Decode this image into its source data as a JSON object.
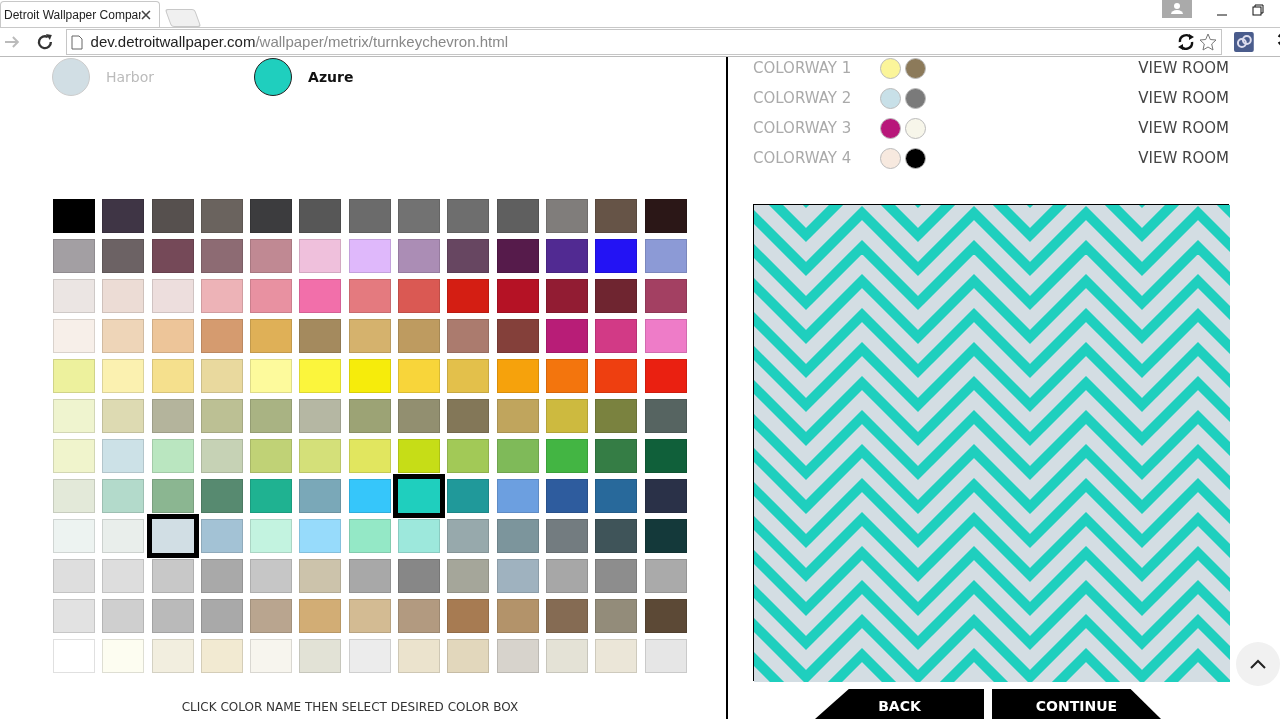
{
  "browser": {
    "tab_title": "Detroit Wallpaper Compar",
    "url": {
      "host": "dev.detroitwallpaper.com",
      "path": "/wallpaper/metrix/turnkeychevron.html"
    }
  },
  "color_choices": [
    {
      "name": "Harbor",
      "color": "#d1dee4",
      "selected": false
    },
    {
      "name": "Azure",
      "color": "#1fcfbe",
      "selected": true
    }
  ],
  "palette": {
    "rows": [
      [
        {
          "color": "#000000",
          "selected": false
        },
        {
          "color": "#3f3545",
          "selected": false
        },
        {
          "color": "#56504e",
          "selected": false
        },
        {
          "color": "#6a635e",
          "selected": false
        },
        {
          "color": "#3c3c3e",
          "selected": false
        },
        {
          "color": "#575757",
          "selected": false
        },
        {
          "color": "#6b6b6b",
          "selected": false
        },
        {
          "color": "#727272",
          "selected": false
        },
        {
          "color": "#6e6e6e",
          "selected": false
        },
        {
          "color": "#5f5f5f",
          "selected": false
        },
        {
          "color": "#807d7b",
          "selected": false
        },
        {
          "color": "#665447",
          "selected": false
        },
        {
          "color": "#2b1717",
          "selected": false
        }
      ],
      [
        {
          "color": "#a39fa3",
          "selected": false
        },
        {
          "color": "#6c6264",
          "selected": false
        },
        {
          "color": "#754958",
          "selected": false
        },
        {
          "color": "#8d6b73",
          "selected": false
        },
        {
          "color": "#c08993",
          "selected": false
        },
        {
          "color": "#efc0dc",
          "selected": false
        },
        {
          "color": "#dfb8fb",
          "selected": false
        },
        {
          "color": "#ab8db5",
          "selected": false
        },
        {
          "color": "#674661",
          "selected": false
        },
        {
          "color": "#561b4b",
          "selected": false
        },
        {
          "color": "#512a92",
          "selected": false
        },
        {
          "color": "#2313f4",
          "selected": false
        },
        {
          "color": "#8c9ad6",
          "selected": false
        }
      ],
      [
        {
          "color": "#ebe5e3",
          "selected": false
        },
        {
          "color": "#ecdcd5",
          "selected": false
        },
        {
          "color": "#eddedd",
          "selected": false
        },
        {
          "color": "#edb3b7",
          "selected": false
        },
        {
          "color": "#e891a1",
          "selected": false
        },
        {
          "color": "#f26faa",
          "selected": false
        },
        {
          "color": "#e47a7f",
          "selected": false
        },
        {
          "color": "#da5953",
          "selected": false
        },
        {
          "color": "#d41e13",
          "selected": false
        },
        {
          "color": "#b51225",
          "selected": false
        },
        {
          "color": "#921c33",
          "selected": false
        },
        {
          "color": "#6f2530",
          "selected": false
        },
        {
          "color": "#a34062",
          "selected": false
        }
      ],
      [
        {
          "color": "#f7efe9",
          "selected": false
        },
        {
          "color": "#eed5b8",
          "selected": false
        },
        {
          "color": "#edc599",
          "selected": false
        },
        {
          "color": "#d59b6f",
          "selected": false
        },
        {
          "color": "#dfb057",
          "selected": false
        },
        {
          "color": "#a48a5e",
          "selected": false
        },
        {
          "color": "#d5b26d",
          "selected": false
        },
        {
          "color": "#be9b60",
          "selected": false
        },
        {
          "color": "#ab7b6e",
          "selected": false
        },
        {
          "color": "#84403a",
          "selected": false
        },
        {
          "color": "#b81d77",
          "selected": false
        },
        {
          "color": "#d23a86",
          "selected": false
        },
        {
          "color": "#ee7cc8",
          "selected": false
        }
      ],
      [
        {
          "color": "#edf19d",
          "selected": false
        },
        {
          "color": "#fbf1b0",
          "selected": false
        },
        {
          "color": "#f5e08d",
          "selected": false
        },
        {
          "color": "#e9d99e",
          "selected": false
        },
        {
          "color": "#fdfa9c",
          "selected": false
        },
        {
          "color": "#fbf53c",
          "selected": false
        },
        {
          "color": "#f6ec0b",
          "selected": false
        },
        {
          "color": "#f8d53a",
          "selected": false
        },
        {
          "color": "#e3c04b",
          "selected": false
        },
        {
          "color": "#f6a20c",
          "selected": false
        },
        {
          "color": "#f3750d",
          "selected": false
        },
        {
          "color": "#ee3f10",
          "selected": false
        },
        {
          "color": "#ea2011",
          "selected": false
        }
      ],
      [
        {
          "color": "#eff4cf",
          "selected": false
        },
        {
          "color": "#dddab2",
          "selected": false
        },
        {
          "color": "#b4b49c",
          "selected": false
        },
        {
          "color": "#bcc094",
          "selected": false
        },
        {
          "color": "#a9b383",
          "selected": false
        },
        {
          "color": "#b5b7a3",
          "selected": false
        },
        {
          "color": "#9ca375",
          "selected": false
        },
        {
          "color": "#928f70",
          "selected": false
        },
        {
          "color": "#837758",
          "selected": false
        },
        {
          "color": "#c0a55d",
          "selected": false
        },
        {
          "color": "#cdba3f",
          "selected": false
        },
        {
          "color": "#7a823f",
          "selected": false
        },
        {
          "color": "#566461",
          "selected": false
        }
      ],
      [
        {
          "color": "#f0f4cc",
          "selected": false
        },
        {
          "color": "#cce1e7",
          "selected": false
        },
        {
          "color": "#bae6c0",
          "selected": false
        },
        {
          "color": "#c6d2b5",
          "selected": false
        },
        {
          "color": "#c0d276",
          "selected": false
        },
        {
          "color": "#d4e079",
          "selected": false
        },
        {
          "color": "#e1e65f",
          "selected": false
        },
        {
          "color": "#c6dd17",
          "selected": false
        },
        {
          "color": "#a2c957",
          "selected": false
        },
        {
          "color": "#7fba59",
          "selected": false
        },
        {
          "color": "#43b543",
          "selected": false
        },
        {
          "color": "#357d45",
          "selected": false
        },
        {
          "color": "#10603a",
          "selected": false
        }
      ],
      [
        {
          "color": "#e3e9d9",
          "selected": false
        },
        {
          "color": "#b3dacb",
          "selected": false
        },
        {
          "color": "#8bb691",
          "selected": false
        },
        {
          "color": "#578a70",
          "selected": false
        },
        {
          "color": "#1fb291",
          "selected": false
        },
        {
          "color": "#7aa8b8",
          "selected": false
        },
        {
          "color": "#36c6fa",
          "selected": false
        },
        {
          "color": "#1fcfbe",
          "selected": true
        },
        {
          "color": "#20999a",
          "selected": false
        },
        {
          "color": "#6c9fe0",
          "selected": false
        },
        {
          "color": "#2e5c9e",
          "selected": false
        },
        {
          "color": "#28699b",
          "selected": false
        },
        {
          "color": "#2a3148",
          "selected": false
        }
      ],
      [
        {
          "color": "#edf3f1",
          "selected": false
        },
        {
          "color": "#e9eeeb",
          "selected": false
        },
        {
          "color": "#d1dee4",
          "selected": true
        },
        {
          "color": "#a3c2d5",
          "selected": false
        },
        {
          "color": "#c3f3e0",
          "selected": false
        },
        {
          "color": "#97dbfb",
          "selected": false
        },
        {
          "color": "#94e8c6",
          "selected": false
        },
        {
          "color": "#9de8dc",
          "selected": false
        },
        {
          "color": "#97a9ac",
          "selected": false
        },
        {
          "color": "#7c959c",
          "selected": false
        },
        {
          "color": "#737c80",
          "selected": false
        },
        {
          "color": "#3f5459",
          "selected": false
        },
        {
          "color": "#14393a",
          "selected": false
        }
      ],
      [
        {
          "color": "#dedede",
          "selected": false
        },
        {
          "color": "#dddddd",
          "selected": false
        },
        {
          "color": "#c8c8c8",
          "selected": false
        },
        {
          "color": "#a9a9a9",
          "selected": false
        },
        {
          "color": "#c6c6c6",
          "selected": false
        },
        {
          "color": "#ccc3ab",
          "selected": false
        },
        {
          "color": "#a8a8a8",
          "selected": false
        },
        {
          "color": "#878787",
          "selected": false
        },
        {
          "color": "#a5a69a",
          "selected": false
        },
        {
          "color": "#9fb2bf",
          "selected": false
        },
        {
          "color": "#a7a7a7",
          "selected": false
        },
        {
          "color": "#8d8d8d",
          "selected": false
        },
        {
          "color": "#aaaaaa",
          "selected": false
        }
      ],
      [
        {
          "color": "#e2e2e2",
          "selected": false
        },
        {
          "color": "#cfcfcf",
          "selected": false
        },
        {
          "color": "#bababa",
          "selected": false
        },
        {
          "color": "#a9a9a9",
          "selected": false
        },
        {
          "color": "#b9a58f",
          "selected": false
        },
        {
          "color": "#d2ad75",
          "selected": false
        },
        {
          "color": "#d3bb93",
          "selected": false
        },
        {
          "color": "#b29a80",
          "selected": false
        },
        {
          "color": "#a77b52",
          "selected": false
        },
        {
          "color": "#b3936a",
          "selected": false
        },
        {
          "color": "#856b53",
          "selected": false
        },
        {
          "color": "#938c7a",
          "selected": false
        },
        {
          "color": "#5c4936",
          "selected": false
        }
      ],
      [
        {
          "color": "#ffffff",
          "selected": false
        },
        {
          "color": "#fdfdf1",
          "selected": false
        },
        {
          "color": "#f2eedf",
          "selected": false
        },
        {
          "color": "#f2ead2",
          "selected": false
        },
        {
          "color": "#f7f5ee",
          "selected": false
        },
        {
          "color": "#e2e2d6",
          "selected": false
        },
        {
          "color": "#ececec",
          "selected": false
        },
        {
          "color": "#ebe3cd",
          "selected": false
        },
        {
          "color": "#e2d7bc",
          "selected": false
        },
        {
          "color": "#d7d3cc",
          "selected": false
        },
        {
          "color": "#e4e2d6",
          "selected": false
        },
        {
          "color": "#ebe6d8",
          "selected": false
        },
        {
          "color": "#e6e6e6",
          "selected": false
        }
      ]
    ]
  },
  "instruction": "CLICK COLOR NAME THEN SELECT DESIRED COLOR BOX",
  "colorways": [
    {
      "label": "COLORWAY 1",
      "colors": [
        {
          "color": "#fbf59a"
        },
        {
          "color": "#8c7a5a"
        }
      ],
      "link": "VIEW ROOM"
    },
    {
      "label": "COLORWAY 2",
      "colors": [
        {
          "color": "#c8e0e8"
        },
        {
          "color": "#7a7a7a"
        }
      ],
      "link": "VIEW ROOM"
    },
    {
      "label": "COLORWAY 3",
      "colors": [
        {
          "color": "#b8177a"
        },
        {
          "color": "#f7f6ea"
        }
      ],
      "link": "VIEW ROOM"
    },
    {
      "label": "COLORWAY 4",
      "colors": [
        {
          "color": "#f7e9df"
        },
        {
          "color": "#000000"
        }
      ],
      "link": "VIEW ROOM"
    }
  ],
  "buttons": [
    {
      "label": "BACK",
      "kind": "back"
    },
    {
      "label": "CONTINUE",
      "kind": "next"
    }
  ]
}
